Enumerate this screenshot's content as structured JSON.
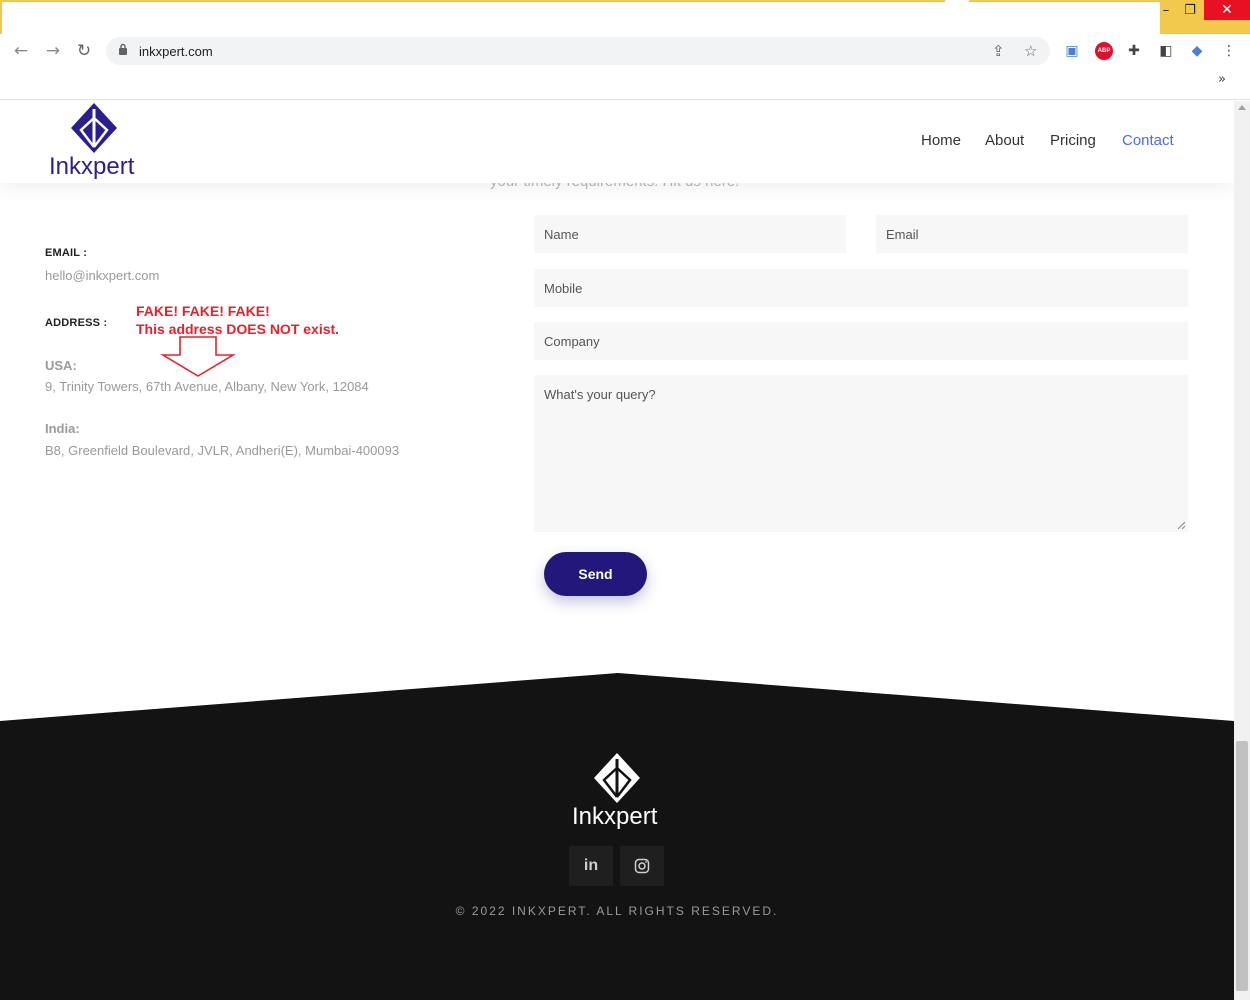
{
  "browser": {
    "url": "inkxpert.com",
    "bookmarks_overflow": "»",
    "abp_label": "ABP"
  },
  "header": {
    "brand": "Inkxpert",
    "nav": [
      "Home",
      "About",
      "Pricing",
      "Contact"
    ],
    "active_nav": "Contact"
  },
  "intro": {
    "subtitle": "your timely requirements. Hit us here!"
  },
  "contact_info": {
    "email_label": "EMAIL :",
    "email": "hello@inkxpert.com",
    "address_label": "ADDRESS :",
    "usa_label": "USA:",
    "usa_address": "9, Trinity Towers, 67th Avenue, Albany, New York, 12084",
    "india_label": "India:",
    "india_address": "B8, Greenfield Boulevard, JVLR, Andheri(E), Mumbai-400093"
  },
  "annotation": {
    "line1": "FAKE! FAKE! FAKE!",
    "line2": "This address DOES NOT exist.",
    "color": "#e5222a"
  },
  "form": {
    "name_placeholder": "Name",
    "email_placeholder": "Email",
    "mobile_placeholder": "Mobile",
    "company_placeholder": "Company",
    "query_placeholder": "What's your query?",
    "send_label": "Send"
  },
  "footer": {
    "brand": "Inkxpert",
    "social": [
      "linkedin-icon",
      "instagram-icon"
    ],
    "linkedin_label": "in",
    "copyright": "© 2022 INKXPERT. ALL RIGHTS RESERVED."
  },
  "colors": {
    "brand": "#2a1f8f",
    "button": "#22177a",
    "active_nav": "#4a6cf0",
    "footer_bg": "#131313"
  }
}
